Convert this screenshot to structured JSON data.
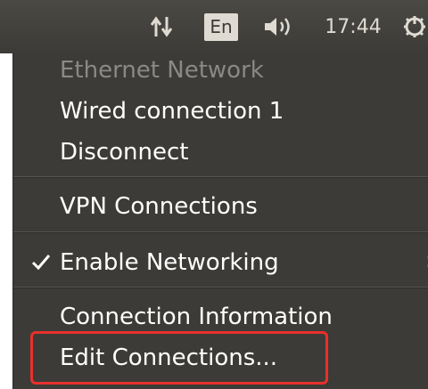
{
  "panel": {
    "network_icon": "network-transfer-icon",
    "keyboard_layout": "En",
    "sound_icon": "volume-icon",
    "clock": "17:44",
    "session_icon": "power-gear-icon"
  },
  "menu": {
    "section_header": "Ethernet Network",
    "wired_connection": "Wired connection 1",
    "disconnect": "Disconnect",
    "vpn_connections": "VPN Connections",
    "enable_networking": "Enable Networking",
    "enable_networking_checked": true,
    "connection_information": "Connection Information",
    "edit_connections": "Edit Connections..."
  },
  "colors": {
    "panel_bg": "#3c3b37",
    "menu_bg": "#3c3b37",
    "menu_text": "#ffffff",
    "disabled_text": "#8a8985",
    "highlight": "#e8302c"
  }
}
